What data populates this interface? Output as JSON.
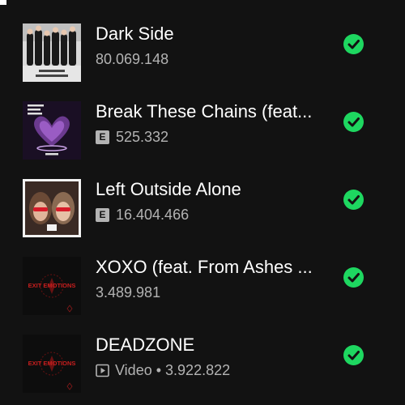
{
  "tracks": [
    {
      "title": "Dark Side",
      "explicit": false,
      "type": "",
      "plays": "80.069.148",
      "art": "band-photo"
    },
    {
      "title": "Break These Chains (feat...",
      "explicit": true,
      "explicit_label": "E",
      "type": "",
      "plays": "525.332",
      "art": "purple-hands"
    },
    {
      "title": "Left Outside Alone",
      "explicit": true,
      "explicit_label": "E",
      "type": "",
      "plays": "16.404.466",
      "art": "two-faces"
    },
    {
      "title": "XOXO (feat. From Ashes ...",
      "explicit": false,
      "type": "",
      "plays": "3.489.981",
      "art": "exit-emotions"
    },
    {
      "title": "DEADZONE",
      "explicit": false,
      "type": "Video",
      "separator": "•",
      "plays": "3.922.822",
      "art": "exit-emotions"
    }
  ],
  "album_art_text": {
    "exit_emotions": "EXIT EMOTIONS"
  },
  "colors": {
    "background": "#121212",
    "primary_text": "#ffffff",
    "secondary_text": "#b3b3b3",
    "accent_green": "#1ed760"
  },
  "icons": {
    "saved": "check-circle-icon",
    "explicit": "explicit-badge",
    "video": "video-icon"
  }
}
